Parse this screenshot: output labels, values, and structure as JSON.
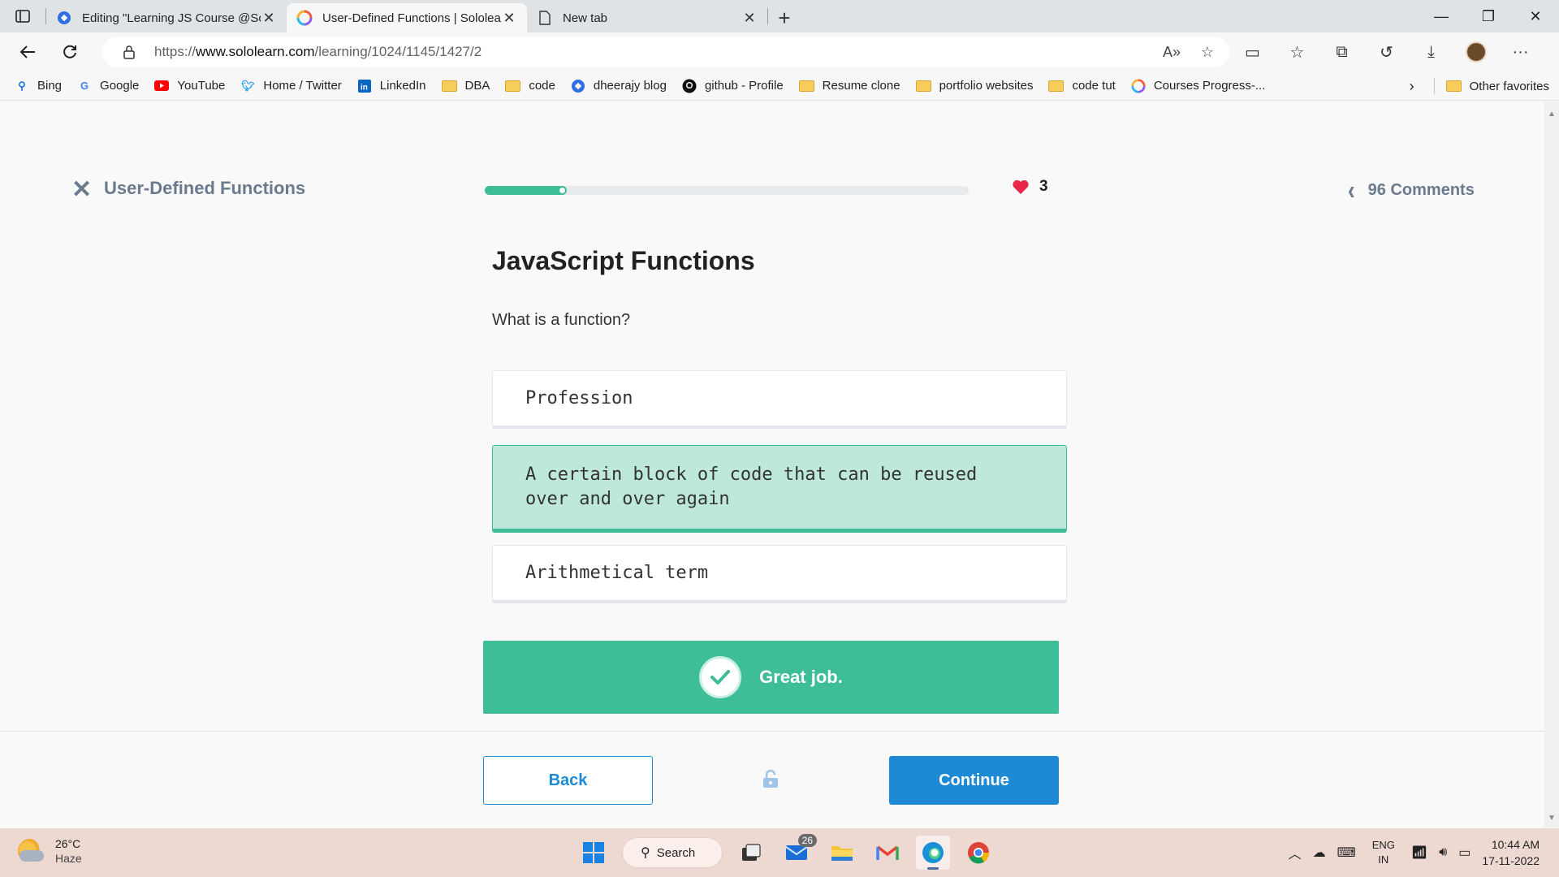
{
  "browser": {
    "tabs": [
      {
        "title": "Editing \"Learning JS Course @Sololearn\"",
        "active": false
      },
      {
        "title": "User-Defined Functions | Sololearn",
        "active": true
      },
      {
        "title": "New tab",
        "active": false
      }
    ],
    "url_prefix": "https://",
    "url_host": "www.sololearn.com",
    "url_path": "/learning/1024/1145/1427/2",
    "favorites": [
      {
        "label": "Bing",
        "icon": "search-icon"
      },
      {
        "label": "Google",
        "icon": "google-icon"
      },
      {
        "label": "YouTube",
        "icon": "youtube-icon"
      },
      {
        "label": "Home / Twitter",
        "icon": "twitter-icon"
      },
      {
        "label": "LinkedIn",
        "icon": "linkedin-icon"
      },
      {
        "label": "DBA",
        "icon": "folder-icon"
      },
      {
        "label": "code",
        "icon": "folder-icon"
      },
      {
        "label": "dheerajy blog",
        "icon": "blog-icon"
      },
      {
        "label": "github - Profile",
        "icon": "github-icon"
      },
      {
        "label": "Resume clone",
        "icon": "folder-icon"
      },
      {
        "label": "portfolio websites",
        "icon": "folder-icon"
      },
      {
        "label": "code tut",
        "icon": "folder-icon"
      },
      {
        "label": "Courses Progress-...",
        "icon": "sololearn-icon"
      }
    ],
    "other_favorites": "Other favorites"
  },
  "lesson": {
    "title": "User-Defined Functions",
    "progress_fraction": 0.17,
    "lives": "3",
    "comments": "96 Comments",
    "heading": "JavaScript Functions",
    "question": "What is a function?",
    "options": [
      {
        "text": "Profession",
        "correct": false
      },
      {
        "text": "A certain block of code that can be reused over and over again",
        "correct": true
      },
      {
        "text": "Arithmetical term",
        "correct": false
      }
    ],
    "feedback": "Great job.",
    "back_label": "Back",
    "continue_label": "Continue"
  },
  "colors": {
    "accent_green": "#3dbd98",
    "accent_blue": "#1e8ad6",
    "heart": "#e8284b"
  },
  "taskbar": {
    "temperature": "26°C",
    "condition": "Haze",
    "search_label": "Search",
    "mail_badge": "26",
    "lang_top": "ENG",
    "lang_bottom": "IN",
    "time": "10:44 AM",
    "date": "17-11-2022"
  }
}
